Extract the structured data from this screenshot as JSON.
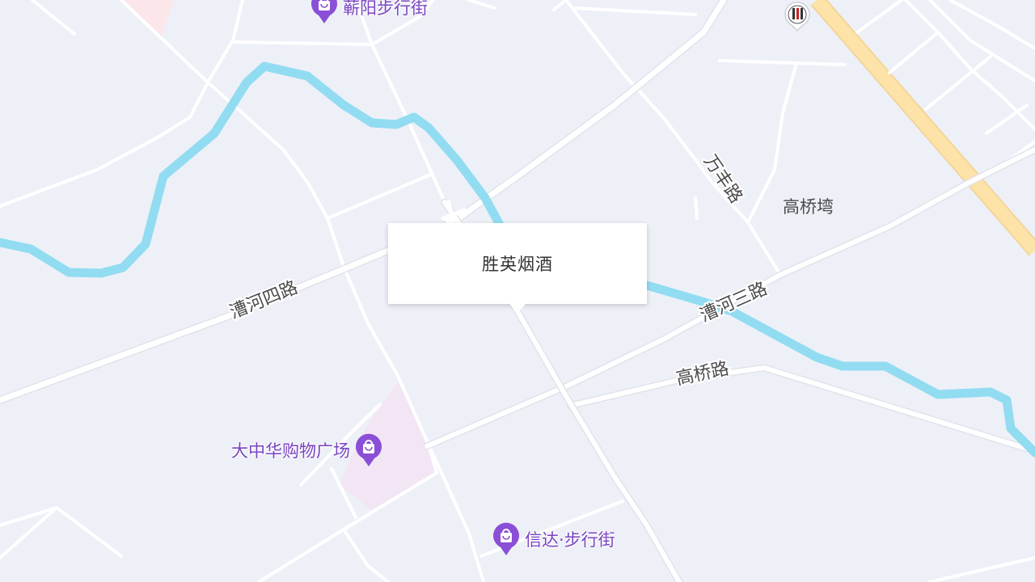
{
  "popup": {
    "title": "胜英烟酒"
  },
  "roads": {
    "caohe_4": "漕河四路",
    "caohe_3": "漕河三路",
    "wanfeng": "万丰路",
    "gaoqiao": "高桥路"
  },
  "areas": {
    "gaoqiaowan": "高桥塆"
  },
  "pois": [
    {
      "label": "蕲阳步行街",
      "icon": "shopping-bag-icon"
    },
    {
      "label": "大中华购物广场",
      "icon": "shopping-bag-icon"
    },
    {
      "label": "信达·步行街",
      "icon": "shopping-bag-icon"
    }
  ],
  "brand_marker": {
    "icon": "gas-station-logo-icon"
  },
  "colors": {
    "background": "#eef0f8",
    "road": "#ffffff",
    "highway": "#fde3a7",
    "river": "#92dcf2",
    "poi_accent": "#8a4fd6",
    "poi_text": "#7a44c2",
    "mall_area": "#f2e6f5"
  }
}
